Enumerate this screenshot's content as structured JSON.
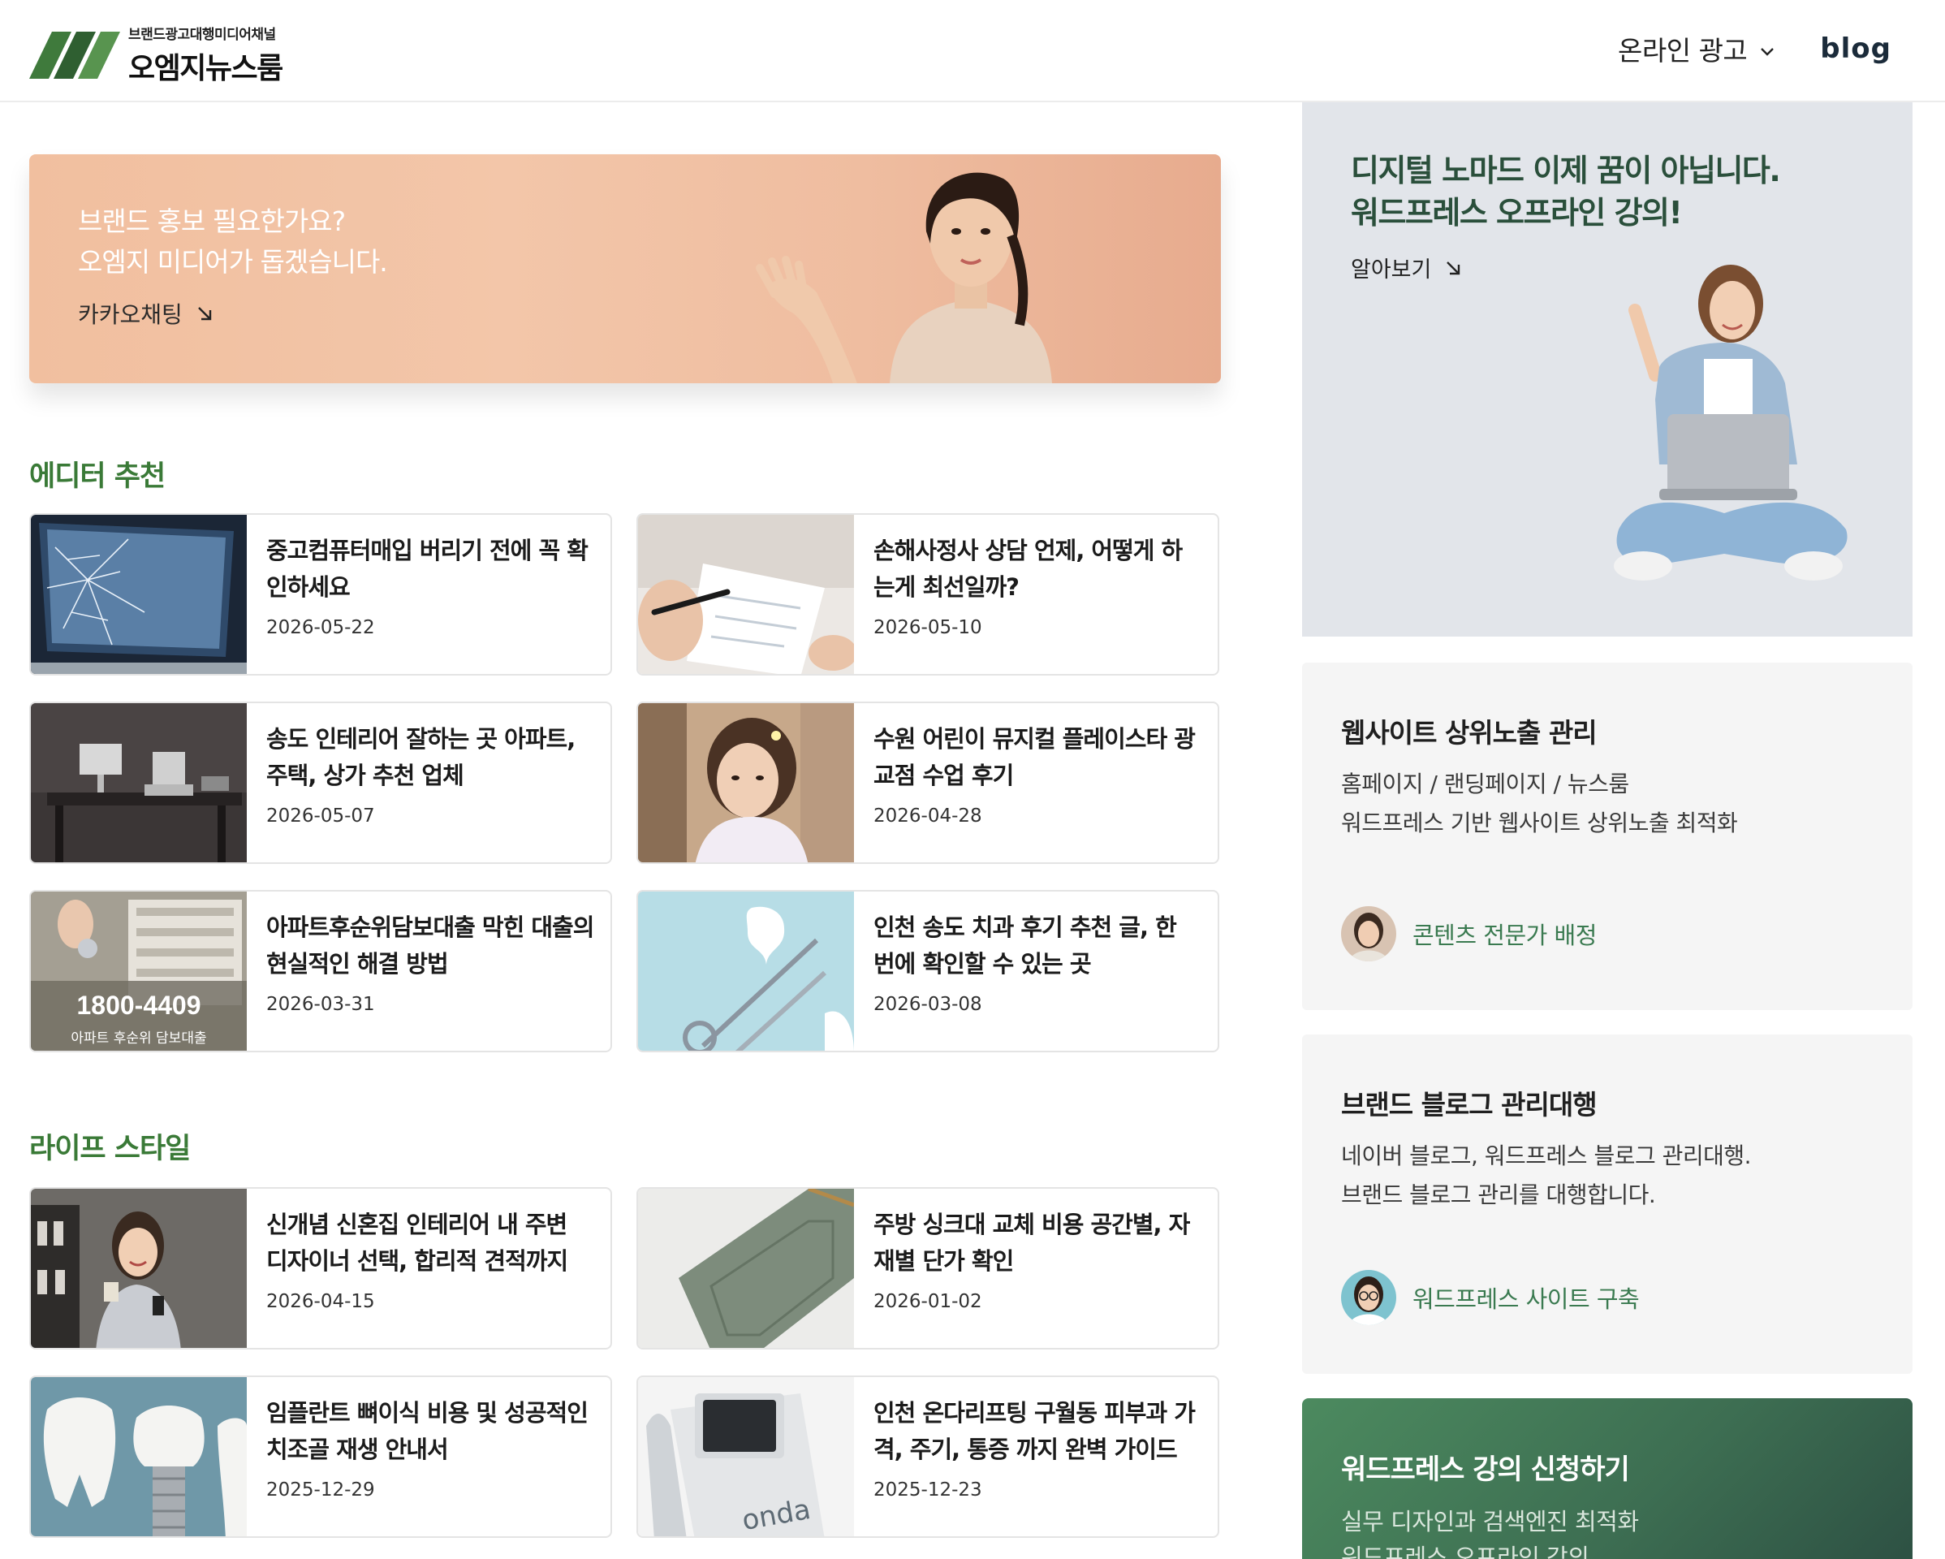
{
  "header": {
    "logo_sub": "브랜드광고대행미디어채널",
    "logo_main": "오엠지뉴스룸",
    "nav_ads": "온라인 광고",
    "nav_blog": "blog"
  },
  "hero": {
    "line1": "브랜드 홍보 필요한가요?",
    "line2": "오엠지 미디어가 돕겠습니다.",
    "link": "카카오채팅"
  },
  "editor_pick": {
    "title": "에디터 추천",
    "cards": [
      {
        "title": "중고컴퓨터매입 버리기 전에 꼭 확인하세요",
        "date": "2026-05-22",
        "thumb": "cracked-laptop"
      },
      {
        "title": "손해사정사 상담 언제, 어떻게 하는게 최선일까?",
        "date": "2026-05-10",
        "thumb": "document-pen"
      },
      {
        "title": "송도 인테리어 잘하는 곳 아파트, 주택, 상가 추천 업체",
        "date": "2026-05-07",
        "thumb": "office-desk"
      },
      {
        "title": "수원 어린이 뮤지컬 플레이스타 광교점 수업 후기",
        "date": "2026-04-28",
        "thumb": "child-portrait"
      },
      {
        "title": "아파트후순위담보대출 막힌 대출의 현실적인 해결 방법",
        "date": "2026-03-31",
        "thumb": "apartment-loan",
        "thumb_phone": "1800-4409",
        "thumb_caption": "아파트 후순위 담보대출"
      },
      {
        "title": "인천 송도 치과 후기 추천 글, 한 번에 확인할 수 있는 곳",
        "date": "2026-03-08",
        "thumb": "dental-tools"
      }
    ]
  },
  "lifestyle": {
    "title": "라이프 스타일",
    "cards": [
      {
        "title": "신개념 신혼집 인테리어 내 주변 디자이너 선택, 합리적 견적까지",
        "date": "2026-04-15",
        "thumb": "woman-coffee"
      },
      {
        "title": "주방 싱크대 교체 비용 공간별, 자재별 단가 확인",
        "date": "2026-01-02",
        "thumb": "cabinet-door"
      },
      {
        "title": "임플란트 뼈이식 비용 및 성공적인 치조골 재생 안내서",
        "date": "2025-12-29",
        "thumb": "dental-implant"
      },
      {
        "title": "인천 온다리프팅 구월동 피부과 가격, 주기, 통증 까지 완벽 가이드",
        "date": "2025-12-23",
        "thumb": "onda-device",
        "thumb_brand": "onda"
      }
    ]
  },
  "sidebar": {
    "hero": {
      "line1": "디지털 노마드 이제 꿈이 아닙니다.",
      "line2": "워드프레스 오프라인 강의!",
      "link": "알아보기"
    },
    "seo": {
      "title": "웹사이트 상위노출 관리",
      "desc1": "홈페이지 / 랜딩페이지 / 뉴스룸",
      "desc2": "워드프레스 기반 웹사이트 상위노출 최적화",
      "link": "콘텐츠 전문가 배정"
    },
    "blog": {
      "title": "브랜드 블로그 관리대행",
      "desc1": "네이버 블로그, 워드프레스 블로그 관리대행.",
      "desc2": "브랜드 블로그 관리를 대행합니다.",
      "link": "워드프레스 사이트 구축"
    },
    "cta": {
      "title": "워드프레스 강의 신청하기",
      "desc1": "실무 디자인과 검색엔진 최적화",
      "desc2": "워드프레스 오프라인 강의"
    }
  },
  "colors": {
    "accent_green": "#3a7a37",
    "link_green": "#3a7a50",
    "hero_peach": "#f1bf9f",
    "side_gray": "#e2e5ea"
  }
}
